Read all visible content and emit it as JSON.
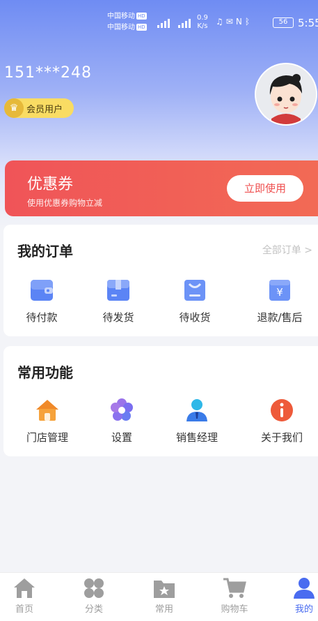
{
  "status_bar": {
    "carrier_1": "中国移动",
    "carrier_2": "中国移动",
    "hd_label": "HD",
    "signal_label": "4G",
    "speed_value": "0.9",
    "speed_unit": "K/s",
    "battery": "56",
    "time": "5:55"
  },
  "profile": {
    "phone": "151***248",
    "member_label": "会员用户"
  },
  "coupon": {
    "title": "优惠券",
    "subtitle": "使用优惠券购物立减",
    "button_label": "立即使用"
  },
  "orders": {
    "title": "我的订单",
    "all_link": "全部订单 >",
    "items": [
      {
        "label": "待付款",
        "icon": "wallet-icon"
      },
      {
        "label": "待发货",
        "icon": "package-icon"
      },
      {
        "label": "待收货",
        "icon": "receive-bag-icon"
      },
      {
        "label": "退款/售后",
        "icon": "refund-icon"
      }
    ]
  },
  "functions": {
    "title": "常用功能",
    "items": [
      {
        "label": "门店管理",
        "icon": "store-home-icon"
      },
      {
        "label": "设置",
        "icon": "settings-flower-icon"
      },
      {
        "label": "销售经理",
        "icon": "manager-person-icon"
      },
      {
        "label": "关于我们",
        "icon": "info-icon"
      }
    ]
  },
  "tabbar": {
    "items": [
      {
        "label": "首页",
        "icon": "home-icon",
        "active": false
      },
      {
        "label": "分类",
        "icon": "category-icon",
        "active": false
      },
      {
        "label": "常用",
        "icon": "folder-star-icon",
        "active": false
      },
      {
        "label": "购物车",
        "icon": "cart-icon",
        "active": false
      },
      {
        "label": "我的",
        "icon": "person-icon",
        "active": true
      }
    ]
  },
  "colors": {
    "header_top": "#6f8cf3",
    "coupon": "#f05458",
    "accent": "#4a6cf0",
    "member_badge": "#f9dc63"
  }
}
